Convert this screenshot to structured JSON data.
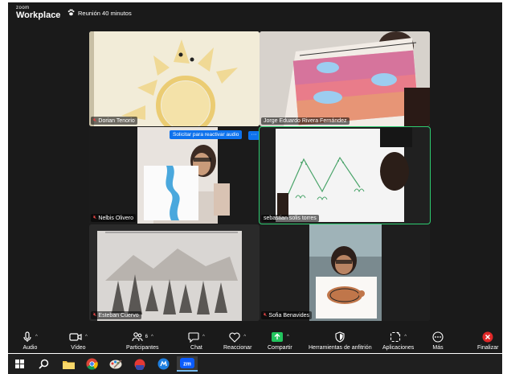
{
  "titlebar": {
    "logo_small": "zoom",
    "logo_big": "Workplace",
    "meeting_label": "Reunión 40 minutos"
  },
  "participants": [
    {
      "name": "Dorian Tenorio",
      "muted": true
    },
    {
      "name": "Jorge Eduardo Rivera Fernández",
      "muted": false
    },
    {
      "name": "Nelbis Olivero",
      "muted": true
    },
    {
      "name": "sebastian solis torres",
      "muted": false,
      "active_speaker": true
    },
    {
      "name": "Esteban Cuervo",
      "muted": true
    },
    {
      "name": "Sofia Benavides",
      "muted": true
    }
  ],
  "overlay": {
    "unmute_request": "Solicitar para reactivar audio",
    "more": "···"
  },
  "toolbar": {
    "audio": "Audio",
    "video": "Vídeo",
    "participants": "Participantes",
    "participants_count": "6",
    "chat": "Chat",
    "reactions": "Reaccionar",
    "share": "Compartir",
    "host_tools": "Herramientas de anfitrión",
    "apps": "Aplicaciones",
    "more": "Más",
    "end": "Finalizar"
  },
  "colors": {
    "accent": "#0e72ed",
    "active_speaker": "#2ecc71",
    "share": "#22c55e",
    "end": "#e02828",
    "muted": "#e54545"
  }
}
